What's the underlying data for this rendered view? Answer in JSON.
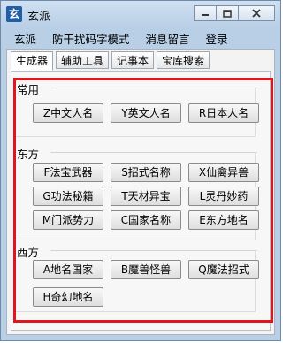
{
  "window": {
    "title": "玄派",
    "app_icon_glyph": "玄"
  },
  "menubar": {
    "items": [
      "玄派",
      "防干扰码字模式",
      "消息留言",
      "登录"
    ]
  },
  "tabs": [
    "生成器",
    "辅助工具",
    "记事本",
    "宝库搜索"
  ],
  "active_tab": 0,
  "groups": [
    {
      "title": "常用",
      "buttons": [
        "Z中文人名",
        "Y英文人名",
        "R日本人名"
      ]
    },
    {
      "title": "东方",
      "buttons": [
        "F法宝武器",
        "S招式名称",
        "X仙禽异兽",
        "G功法秘籍",
        "T天材异宝",
        "L灵丹妙药",
        "M门派势力",
        "C国家名称",
        "E东方地名"
      ]
    },
    {
      "title": "西方",
      "buttons": [
        "A地名国家",
        "B魔兽怪兽",
        "Q魔法招式",
        "H奇幻地名"
      ]
    }
  ],
  "colors": {
    "highlight_frame": "#e0161c",
    "title_bar": "#b9cfe6"
  }
}
